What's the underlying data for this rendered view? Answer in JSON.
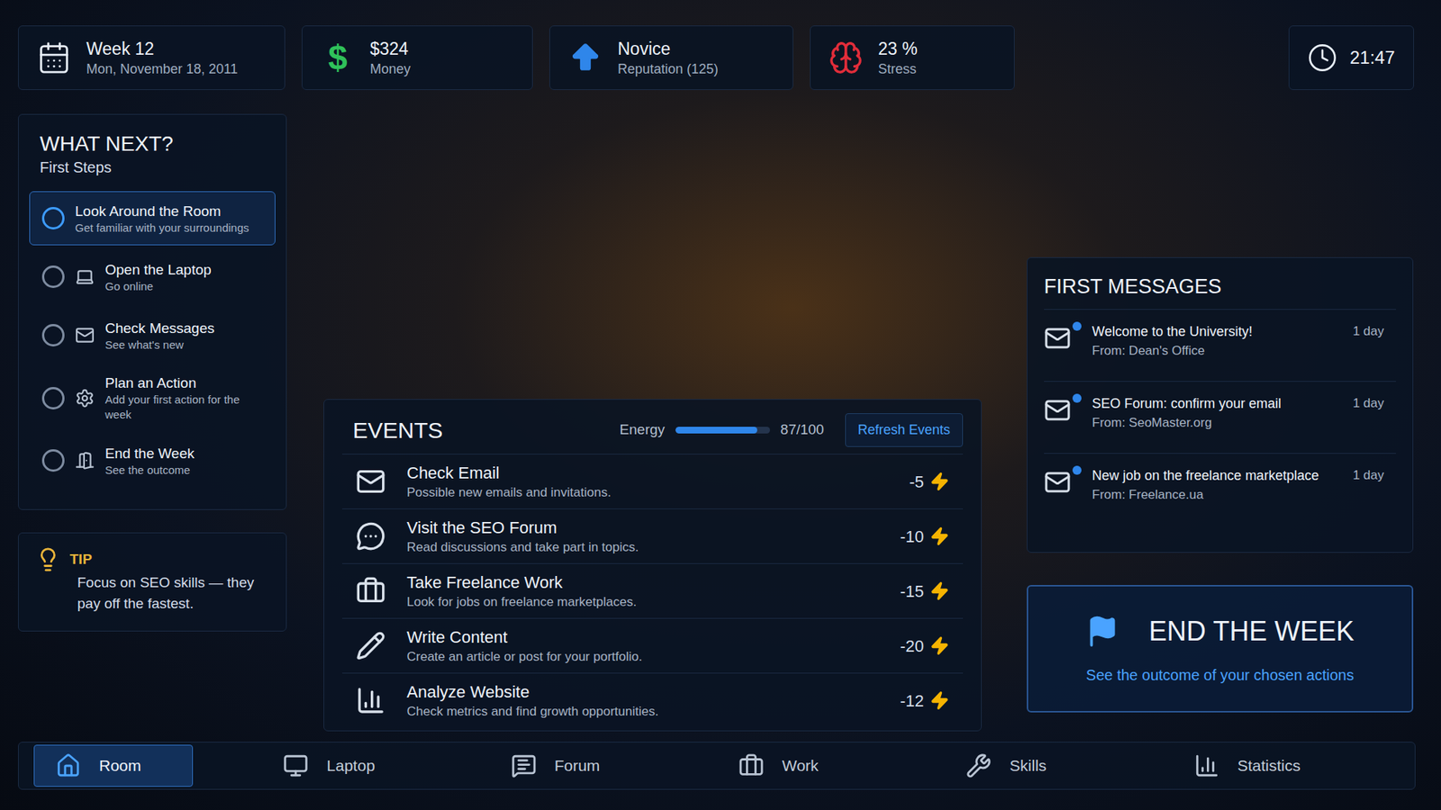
{
  "stats": [
    {
      "kind": "date",
      "value": "Week 12",
      "label": "Mon, November 18, 2011"
    },
    {
      "kind": "money",
      "symbol": "$",
      "value": "$324",
      "label": "Money"
    },
    {
      "kind": "reputation",
      "value": "Novice",
      "label": "Reputation (125)"
    },
    {
      "kind": "stress",
      "value": "23 %",
      "label": "Stress"
    }
  ],
  "clock": "21:47",
  "what_next": {
    "title": "WHAT NEXT?",
    "subtitle": "First Steps",
    "items": [
      {
        "kind": "plain",
        "title": "Look Around the Room",
        "desc": "Get familiar with your surroundings",
        "selected": true,
        "checked": false
      },
      {
        "kind": "laptop",
        "title": "Open the Laptop",
        "desc": "Go online",
        "selected": false,
        "checked": false
      },
      {
        "kind": "mail",
        "title": "Check Messages",
        "desc": "See what's new",
        "selected": false,
        "checked": false
      },
      {
        "kind": "gear",
        "title": "Plan an Action",
        "desc": "Add your first action for the week",
        "selected": false,
        "checked": false
      },
      {
        "kind": "door",
        "title": "End the Week",
        "desc": "See the outcome",
        "selected": false,
        "checked": false
      }
    ]
  },
  "tip": {
    "label": "TIP",
    "text": "Focus on SEO skills — they pay off the fastest."
  },
  "events": {
    "title": "EVENTS",
    "energy_label": "Energy",
    "energy_level": 0.87,
    "energy_reading": "87/100",
    "refresh_button": "Refresh Events",
    "items": [
      {
        "kind": "mail",
        "title": "Check Email",
        "desc": "Possible new emails and invitations.",
        "cost": "-5"
      },
      {
        "kind": "forum",
        "title": "Visit the SEO Forum",
        "desc": "Read discussions and take part in topics.",
        "cost": "-10"
      },
      {
        "kind": "work",
        "title": "Take Freelance Work",
        "desc": "Look for jobs on freelance marketplaces.",
        "cost": "-15"
      },
      {
        "kind": "write",
        "title": "Write Content",
        "desc": "Create an article or post for your portfolio.",
        "cost": "-20"
      },
      {
        "kind": "analyze",
        "title": "Analyze Website",
        "desc": "Check metrics and find growth opportunities.",
        "cost": "-12"
      }
    ]
  },
  "messages": {
    "title": "FIRST MESSAGES",
    "items": [
      {
        "subject": "Welcome to the University!",
        "from": "From: Dean's Office",
        "age": "1 day",
        "unread": true
      },
      {
        "subject": "SEO Forum: confirm your email",
        "from": "From: SeoMaster.org",
        "age": "1 day",
        "unread": true
      },
      {
        "subject": "New job on the freelance marketplace",
        "from": "From: Freelance.ua",
        "age": "1 day",
        "unread": true
      }
    ]
  },
  "end_week": {
    "title": "END THE WEEK",
    "subtitle": "See the outcome of your chosen actions"
  },
  "nav": [
    {
      "kind": "room",
      "label": "Room",
      "selected": true
    },
    {
      "kind": "laptop",
      "label": "Laptop",
      "selected": false
    },
    {
      "kind": "forum",
      "label": "Forum",
      "selected": false
    },
    {
      "kind": "work",
      "label": "Work",
      "selected": false
    },
    {
      "kind": "skills",
      "label": "Skills",
      "selected": false
    },
    {
      "kind": "statistics",
      "label": "Statistics",
      "selected": false
    }
  ]
}
